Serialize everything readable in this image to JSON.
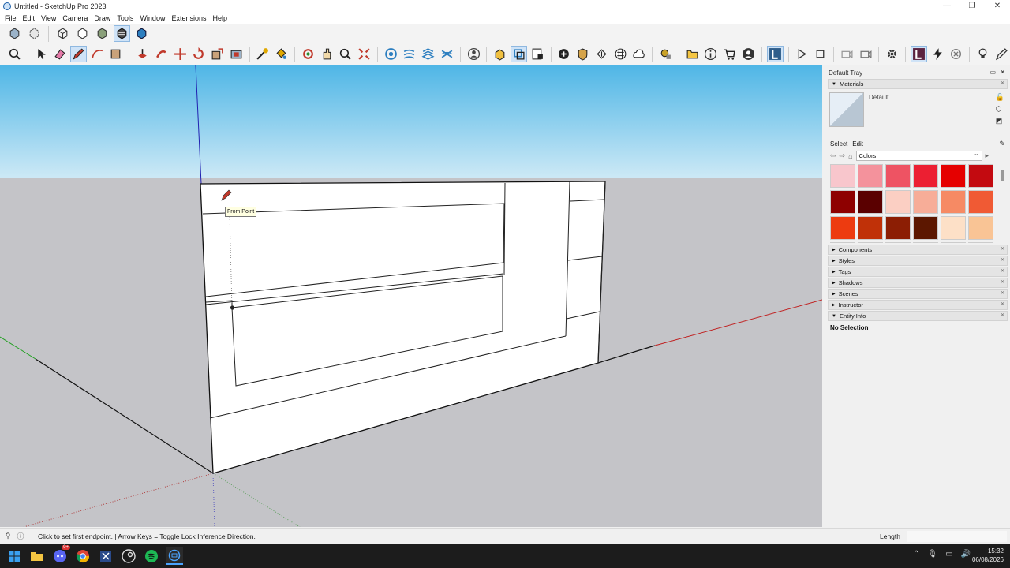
{
  "window": {
    "title": "Untitled - SketchUp Pro 2023",
    "controls": [
      "—",
      "❐",
      "✕"
    ]
  },
  "menu": [
    "File",
    "Edit",
    "View",
    "Camera",
    "Draw",
    "Tools",
    "Window",
    "Extensions",
    "Help"
  ],
  "viewport": {
    "tooltip": "From Point"
  },
  "tray": {
    "title": "Default Tray",
    "materials": {
      "header": "Materials",
      "current_name": "Default",
      "tab_select": "Select",
      "tab_edit": "Edit",
      "library": "Colors",
      "swatches": [
        "#f8c6cc",
        "#f4929c",
        "#ee5363",
        "#ec1f32",
        "#e50000",
        "#c30a10",
        "#8e0000",
        "#5a0000",
        "#fbcfc3",
        "#f7ad98",
        "#f68a64",
        "#f05a34",
        "#ed3b10",
        "#c03108",
        "#8c1e04",
        "#5c1700",
        "#fde0c7",
        "#f9c495",
        "#f8b464",
        "#f6a03d",
        "#f18600",
        "#c86b00",
        "#8f4806",
        "#5c3306"
      ]
    },
    "panels": [
      "Components",
      "Styles",
      "Tags",
      "Shadows",
      "Scenes",
      "Instructor"
    ],
    "entity_info": {
      "header": "Entity Info",
      "body": "No Selection"
    }
  },
  "status": {
    "message": "Click to set first endpoint. | Arrow Keys = Toggle Lock Inference Direction.",
    "measure_label": "Length"
  },
  "taskbar": {
    "time": "15:32",
    "date": "06/08/2026",
    "badge": "9+"
  }
}
